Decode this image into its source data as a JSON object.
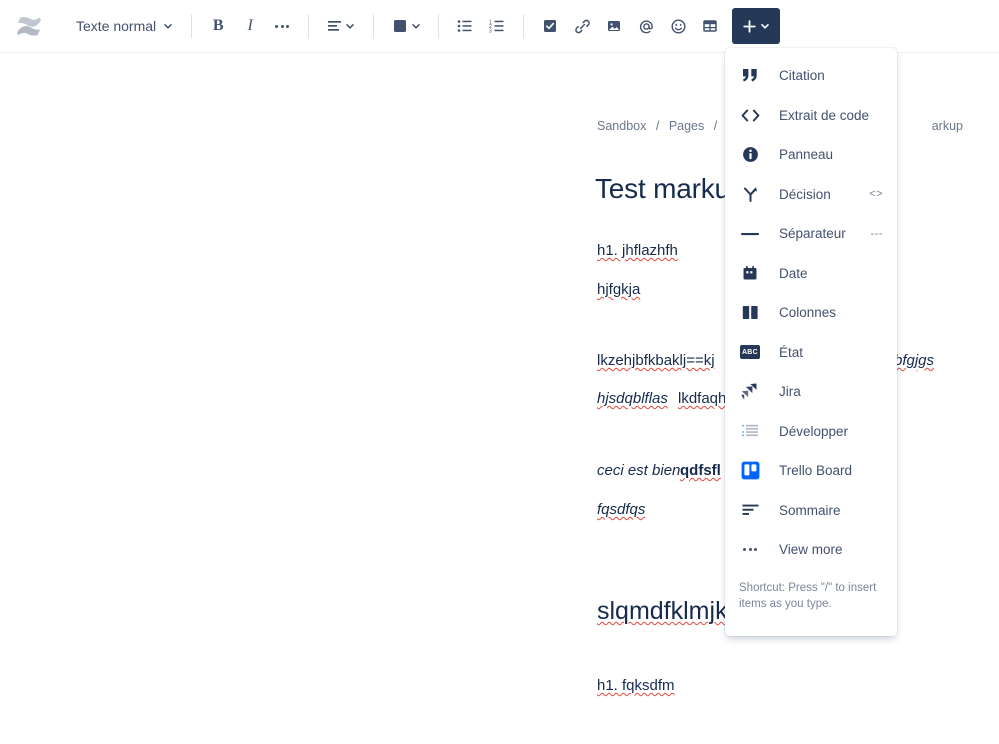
{
  "toolbar": {
    "logo_name": "confluence-logo",
    "style_select": {
      "label": "Texte normal",
      "name": "text-style-select"
    },
    "buttons": [
      {
        "name": "bold-button",
        "icon": "bold-icon",
        "label": "B"
      },
      {
        "name": "italic-button",
        "icon": "italic-icon",
        "label": "I"
      },
      {
        "name": "more-formatting-button",
        "icon": "ellipsis-icon",
        "label": ""
      },
      {
        "name": "text-align-button",
        "icon": "align-left-icon",
        "label": ""
      },
      {
        "name": "text-color-button",
        "icon": "color-swatch-icon",
        "label": ""
      },
      {
        "name": "bullet-list-button",
        "icon": "bullet-list-icon",
        "label": ""
      },
      {
        "name": "numbered-list-button",
        "icon": "numbered-list-icon",
        "label": ""
      },
      {
        "name": "task-list-button",
        "icon": "checkbox-icon",
        "label": ""
      },
      {
        "name": "link-button",
        "icon": "link-icon",
        "label": ""
      },
      {
        "name": "image-button",
        "icon": "image-icon",
        "label": ""
      },
      {
        "name": "mention-button",
        "icon": "at-mention-icon",
        "label": ""
      },
      {
        "name": "emoji-button",
        "icon": "emoji-icon",
        "label": ""
      },
      {
        "name": "table-button",
        "icon": "table-icon",
        "label": ""
      }
    ],
    "insert_button": {
      "name": "insert-menu-button",
      "icon": "plus-icon"
    },
    "accent_color": "#253858",
    "icon_color": "#42526e"
  },
  "breadcrumb": {
    "space": "Sandbox",
    "section": "Pages",
    "page_truncated": "arkup",
    "separator": "/"
  },
  "document": {
    "title": "Test markup",
    "lines": [
      {
        "text": "h1. jhflazhfh",
        "style": "plain"
      },
      {
        "text": "hjfgkja",
        "style": "plain"
      },
      {
        "text": "lkzehjbfkbaklj==kj",
        "style": "plain"
      },
      {
        "text": "bfgjgs",
        "style": "italic"
      },
      {
        "text": "hjsdqblflas",
        "style": "italic"
      },
      {
        "text": "lkdfaqh",
        "style": "plain"
      },
      {
        "text": "ceci est bien ",
        "style": "italic"
      },
      {
        "text": "qdfsfl",
        "style": "bold"
      },
      {
        "text": "fqsdfqs",
        "style": "italic"
      },
      {
        "text": "slqmdfklmjks",
        "style": "heading"
      },
      {
        "text": "h1. fqksdfm",
        "style": "plain"
      }
    ]
  },
  "insert_menu": {
    "items": [
      {
        "label": "Citation",
        "icon": "quote-icon",
        "hint": "",
        "name": "menu-item-citation"
      },
      {
        "label": "Extrait de code",
        "icon": "code-icon",
        "hint": "",
        "name": "menu-item-code-snippet"
      },
      {
        "label": "Panneau",
        "icon": "info-panel-icon",
        "hint": "",
        "name": "menu-item-panel"
      },
      {
        "label": "Décision",
        "icon": "decision-icon",
        "hint": "<>",
        "name": "menu-item-decision"
      },
      {
        "label": "Séparateur",
        "icon": "divider-icon",
        "hint": "---",
        "name": "menu-item-divider"
      },
      {
        "label": "Date",
        "icon": "calendar-icon",
        "hint": "",
        "name": "menu-item-date"
      },
      {
        "label": "Colonnes",
        "icon": "columns-icon",
        "hint": "",
        "name": "menu-item-columns"
      },
      {
        "label": "État",
        "icon": "status-abc-icon",
        "hint": "",
        "name": "menu-item-status"
      },
      {
        "label": "Jira",
        "icon": "jira-icon",
        "hint": "",
        "name": "menu-item-jira"
      },
      {
        "label": "Développer",
        "icon": "expand-icon",
        "hint": "",
        "name": "menu-item-expand"
      },
      {
        "label": "Trello Board",
        "icon": "trello-icon",
        "hint": "",
        "name": "menu-item-trello-board"
      },
      {
        "label": "Sommaire",
        "icon": "toc-icon",
        "hint": "",
        "name": "menu-item-table-of-contents"
      },
      {
        "label": "View more",
        "icon": "ellipsis-icon",
        "hint": "",
        "name": "menu-item-view-more"
      }
    ],
    "footer": "Shortcut: Press \"/\" to insert items as you type."
  }
}
